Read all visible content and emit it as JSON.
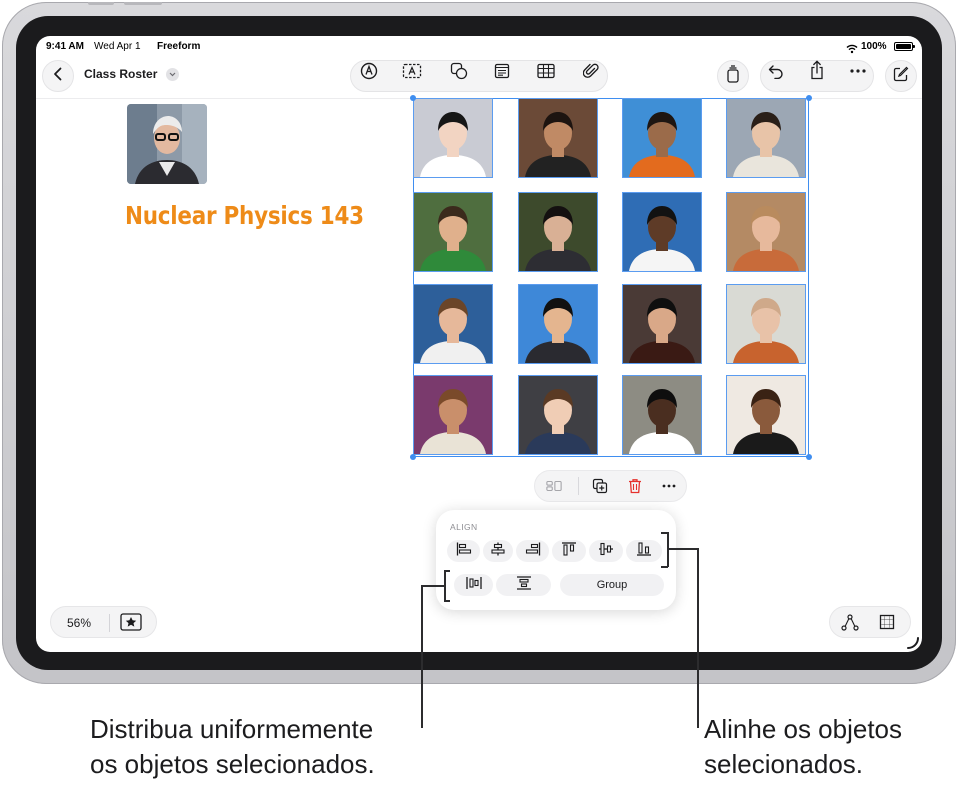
{
  "status_bar": {
    "time": "9:41 AM",
    "date": "Wed Apr 1",
    "app": "Freeform",
    "battery": "100%",
    "icons": [
      "wifi-icon",
      "battery-icon"
    ]
  },
  "toolbar": {
    "doc_title": "Class Roster",
    "left_icons": [
      "back-chevron-icon",
      "title-dropdown-chevron-icon"
    ],
    "center_tools": [
      "pen-tool-icon",
      "text-box-icon",
      "shapes-icon",
      "sticky-note-icon",
      "table-icon",
      "attachment-icon"
    ],
    "right_tools": [
      "recently-deleted-icon",
      "undo-icon",
      "share-icon",
      "more-icon",
      "new-board-icon"
    ]
  },
  "board": {
    "title": "Nuclear Physics 143",
    "title_color": "#ee8b18",
    "selection_color": "#3f8ef0",
    "featured_photo": "teacher-portrait",
    "photos": [
      "student-portrait-1",
      "student-portrait-2",
      "student-portrait-3",
      "student-portrait-4",
      "student-portrait-5",
      "student-portrait-6",
      "student-portrait-7",
      "student-portrait-8",
      "student-portrait-9",
      "student-portrait-10",
      "student-portrait-11",
      "student-portrait-12",
      "student-portrait-13",
      "student-portrait-14",
      "student-portrait-15",
      "student-portrait-16"
    ]
  },
  "context_menu": {
    "buttons": [
      "arrange-icon",
      "duplicate-icon",
      "delete-icon",
      "more-icon"
    ],
    "delete_color": "#e5322d"
  },
  "align_panel": {
    "heading": "ALIGN",
    "align_buttons": [
      "align-left-icon",
      "align-center-horizontal-icon",
      "align-right-icon",
      "align-top-icon",
      "align-middle-icon",
      "align-bottom-icon"
    ],
    "distribute_buttons": [
      "distribute-horizontally-icon",
      "distribute-vertically-icon"
    ],
    "group_label": "Group"
  },
  "bottom_bar": {
    "zoom": "56%",
    "left_icons": [
      "favorite-star-icon"
    ],
    "right_icons": [
      "connection-lines-icon",
      "grid-icon"
    ]
  },
  "callouts": {
    "distribute_line1": "Distribua uniformemente",
    "distribute_line2": "os objetos selecionados.",
    "align_line1": "Alinhe os objetos",
    "align_line2": "selecionados."
  }
}
